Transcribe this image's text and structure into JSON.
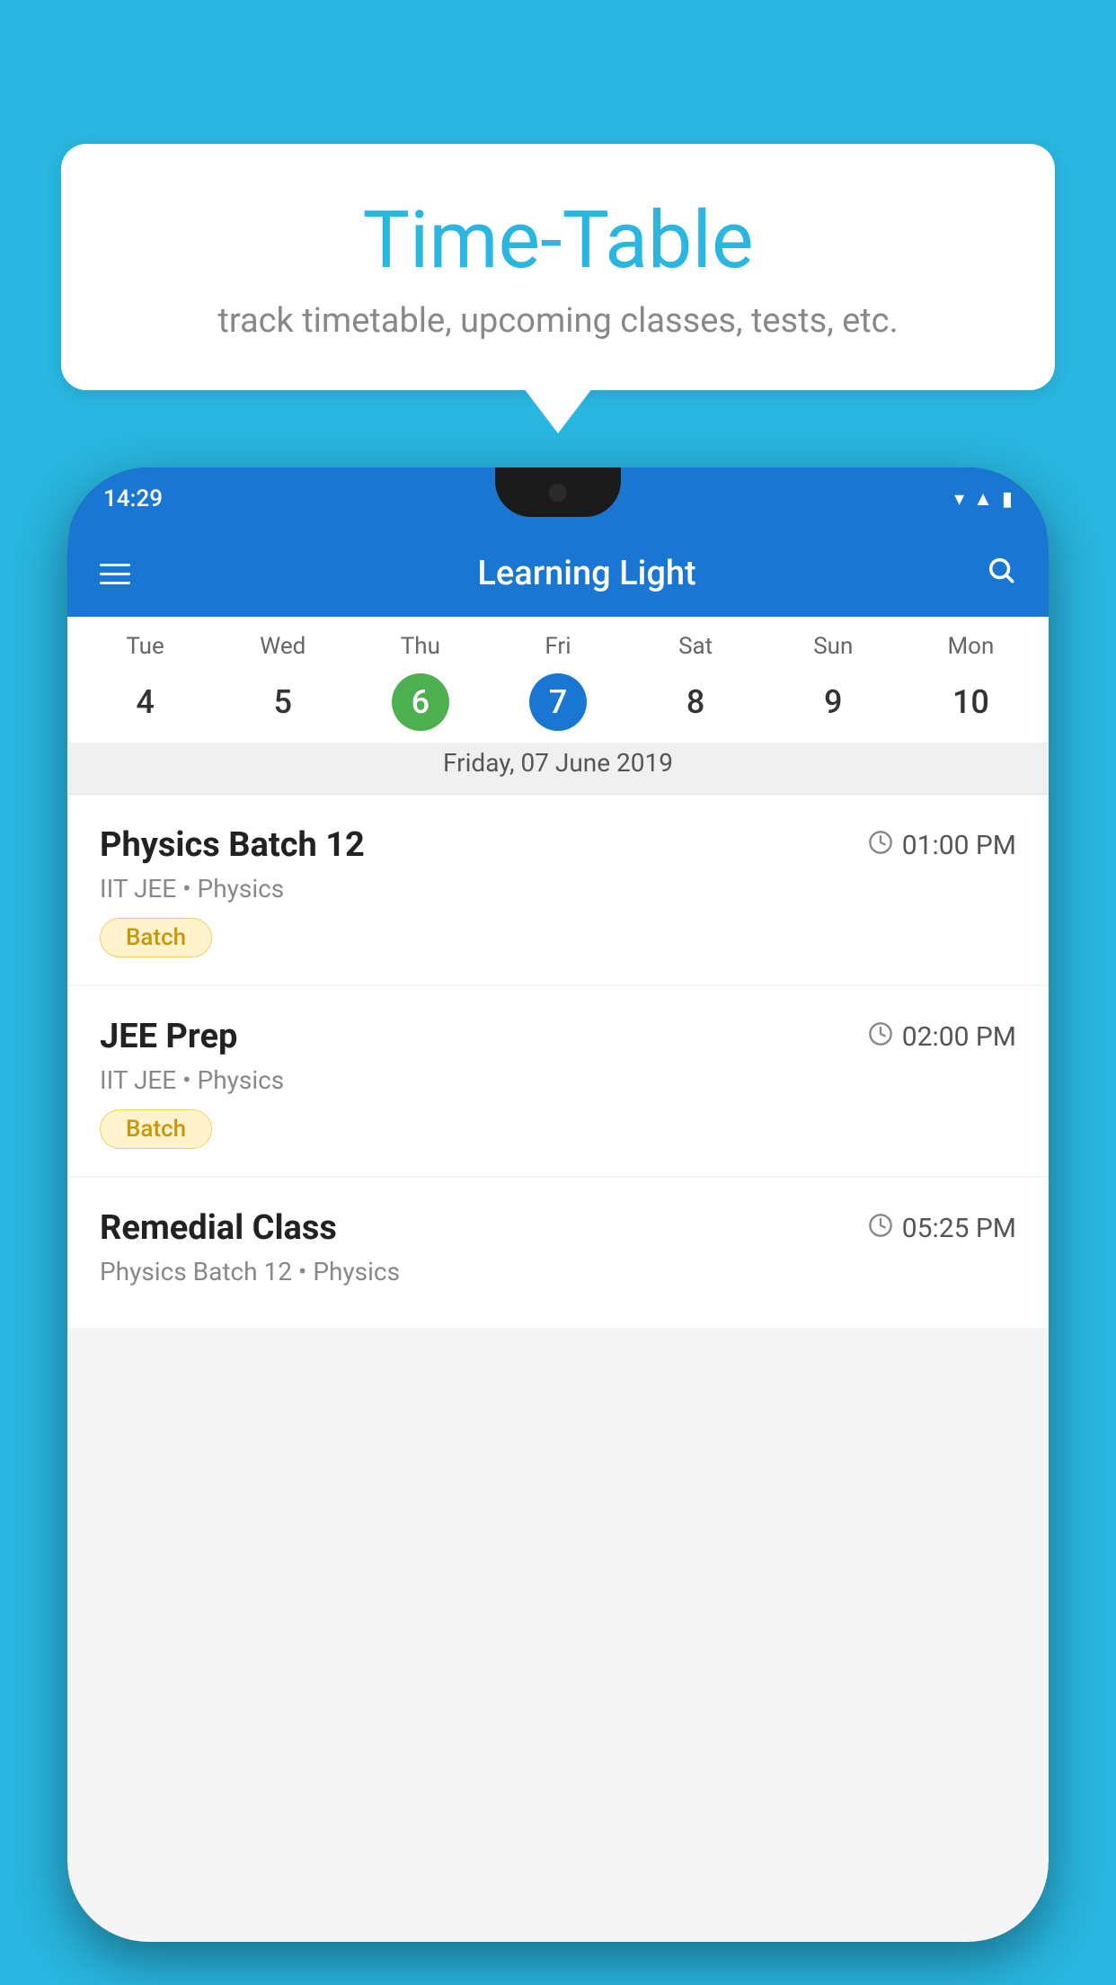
{
  "background_color": "#29b6e0",
  "speech_bubble": {
    "title": "Time-Table",
    "subtitle": "track timetable, upcoming classes, tests, etc."
  },
  "phone": {
    "status_bar": {
      "time": "14:29"
    },
    "app_header": {
      "title": "Learning Light"
    },
    "calendar": {
      "days_of_week": [
        "Tue",
        "Wed",
        "Thu",
        "Fri",
        "Sat",
        "Sun",
        "Mon"
      ],
      "dates": [
        "4",
        "5",
        "6",
        "7",
        "8",
        "9",
        "10"
      ],
      "today_index": 2,
      "selected_index": 3,
      "selected_date_label": "Friday, 07 June 2019"
    },
    "classes": [
      {
        "name": "Physics Batch 12",
        "time": "01:00 PM",
        "meta": "IIT JEE • Physics",
        "badge": "Batch"
      },
      {
        "name": "JEE Prep",
        "time": "02:00 PM",
        "meta": "IIT JEE • Physics",
        "badge": "Batch"
      },
      {
        "name": "Remedial Class",
        "time": "05:25 PM",
        "meta": "Physics Batch 12 • Physics",
        "badge": ""
      }
    ]
  },
  "icons": {
    "hamburger": "☰",
    "search": "🔍",
    "clock": "🕐"
  }
}
